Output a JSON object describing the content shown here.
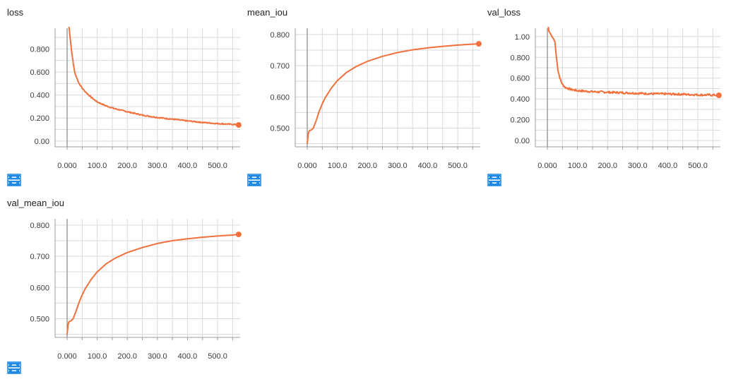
{
  "colors": {
    "series": "#f2703b",
    "grid": "#d9d9d9",
    "axis": "#9e9e9e",
    "zero_line": "#888888",
    "icon": "#1e88e5"
  },
  "buttons": {
    "fullscreen": "fullscreen-icon",
    "lines": "list-lines-icon",
    "fit": "fit-domain-icon"
  },
  "chart_data": [
    {
      "type": "line",
      "title": "loss",
      "xlim": [
        -40,
        575
      ],
      "ylim": [
        -0.05,
        0.98
      ],
      "x_ticks": [
        0,
        100,
        200,
        300,
        400,
        500
      ],
      "x_tick_labels": [
        "0.000",
        "100.0",
        "200.0",
        "300.0",
        "400.0",
        "500.0"
      ],
      "y_ticks": [
        0,
        0.2,
        0.4,
        0.6,
        0.8
      ],
      "y_tick_labels": [
        "0.00",
        "0.200",
        "0.400",
        "0.600",
        "0.800"
      ],
      "grid": true,
      "noise": 0.005,
      "series": [
        {
          "x": [
            5,
            10,
            15,
            20,
            25,
            30,
            40,
            50,
            60,
            80,
            100,
            130,
            160,
            200,
            250,
            300,
            350,
            400,
            450,
            500,
            550,
            570
          ],
          "y": [
            1.02,
            0.9,
            0.78,
            0.68,
            0.6,
            0.56,
            0.5,
            0.46,
            0.43,
            0.38,
            0.34,
            0.305,
            0.28,
            0.255,
            0.225,
            0.205,
            0.19,
            0.175,
            0.162,
            0.152,
            0.145,
            0.14
          ]
        }
      ],
      "last_point": [
        570,
        0.14
      ]
    },
    {
      "type": "line",
      "title": "mean_iou",
      "xlim": [
        -40,
        575
      ],
      "ylim": [
        0.44,
        0.82
      ],
      "x_ticks": [
        0,
        100,
        200,
        300,
        400,
        500
      ],
      "x_tick_labels": [
        "0.000",
        "100.0",
        "200.0",
        "300.0",
        "400.0",
        "500.0"
      ],
      "y_ticks": [
        0.5,
        0.6,
        0.7,
        0.8
      ],
      "y_tick_labels": [
        "0.500",
        "0.600",
        "0.700",
        "0.800"
      ],
      "grid": true,
      "noise": 0,
      "series": [
        {
          "x": [
            0,
            3,
            6,
            10,
            15,
            20,
            30,
            40,
            50,
            60,
            80,
            100,
            130,
            160,
            200,
            250,
            300,
            350,
            400,
            450,
            500,
            550,
            570
          ],
          "y": [
            0.45,
            0.48,
            0.49,
            0.493,
            0.495,
            0.5,
            0.525,
            0.555,
            0.578,
            0.598,
            0.628,
            0.652,
            0.678,
            0.696,
            0.714,
            0.73,
            0.742,
            0.751,
            0.757,
            0.762,
            0.766,
            0.769,
            0.77
          ]
        }
      ],
      "last_point": [
        570,
        0.77
      ]
    },
    {
      "type": "line",
      "title": "val_loss",
      "xlim": [
        -40,
        575
      ],
      "ylim": [
        -0.06,
        1.08
      ],
      "x_ticks": [
        0,
        100,
        200,
        300,
        400,
        500
      ],
      "x_tick_labels": [
        "0.000",
        "100.0",
        "200.0",
        "300.0",
        "400.0",
        "500.0"
      ],
      "y_ticks": [
        0,
        0.2,
        0.4,
        0.6,
        0.8,
        1.0
      ],
      "y_tick_labels": [
        "0.00",
        "0.200",
        "0.400",
        "0.600",
        "0.800",
        "1.00"
      ],
      "grid": true,
      "noise": 0.01,
      "series": [
        {
          "x": [
            2,
            5,
            10,
            15,
            20,
            25,
            30,
            35,
            40,
            45,
            50,
            60,
            70,
            80,
            100,
            150,
            200,
            250,
            300,
            350,
            400,
            450,
            500,
            550,
            570
          ],
          "y": [
            1.12,
            1.05,
            1.03,
            1.0,
            0.98,
            0.95,
            0.8,
            0.68,
            0.62,
            0.57,
            0.54,
            0.51,
            0.5,
            0.49,
            0.48,
            0.47,
            0.465,
            0.46,
            0.455,
            0.45,
            0.448,
            0.445,
            0.44,
            0.438,
            0.435
          ]
        }
      ],
      "last_point": [
        570,
        0.435
      ]
    },
    {
      "type": "line",
      "title": "val_mean_iou",
      "xlim": [
        -40,
        575
      ],
      "ylim": [
        0.44,
        0.82
      ],
      "x_ticks": [
        0,
        100,
        200,
        300,
        400,
        500
      ],
      "x_tick_labels": [
        "0.000",
        "100.0",
        "200.0",
        "300.0",
        "400.0",
        "500.0"
      ],
      "y_ticks": [
        0.5,
        0.6,
        0.7,
        0.8
      ],
      "y_tick_labels": [
        "0.500",
        "0.600",
        "0.700",
        "0.800"
      ],
      "grid": true,
      "noise": 0,
      "series": [
        {
          "x": [
            0,
            3,
            6,
            10,
            15,
            20,
            30,
            40,
            50,
            60,
            80,
            100,
            130,
            160,
            200,
            250,
            300,
            350,
            400,
            450,
            500,
            550,
            570
          ],
          "y": [
            0.45,
            0.48,
            0.49,
            0.492,
            0.495,
            0.5,
            0.525,
            0.553,
            0.576,
            0.596,
            0.626,
            0.65,
            0.676,
            0.694,
            0.712,
            0.728,
            0.741,
            0.75,
            0.756,
            0.761,
            0.765,
            0.768,
            0.77
          ]
        }
      ],
      "last_point": [
        570,
        0.77
      ]
    }
  ]
}
